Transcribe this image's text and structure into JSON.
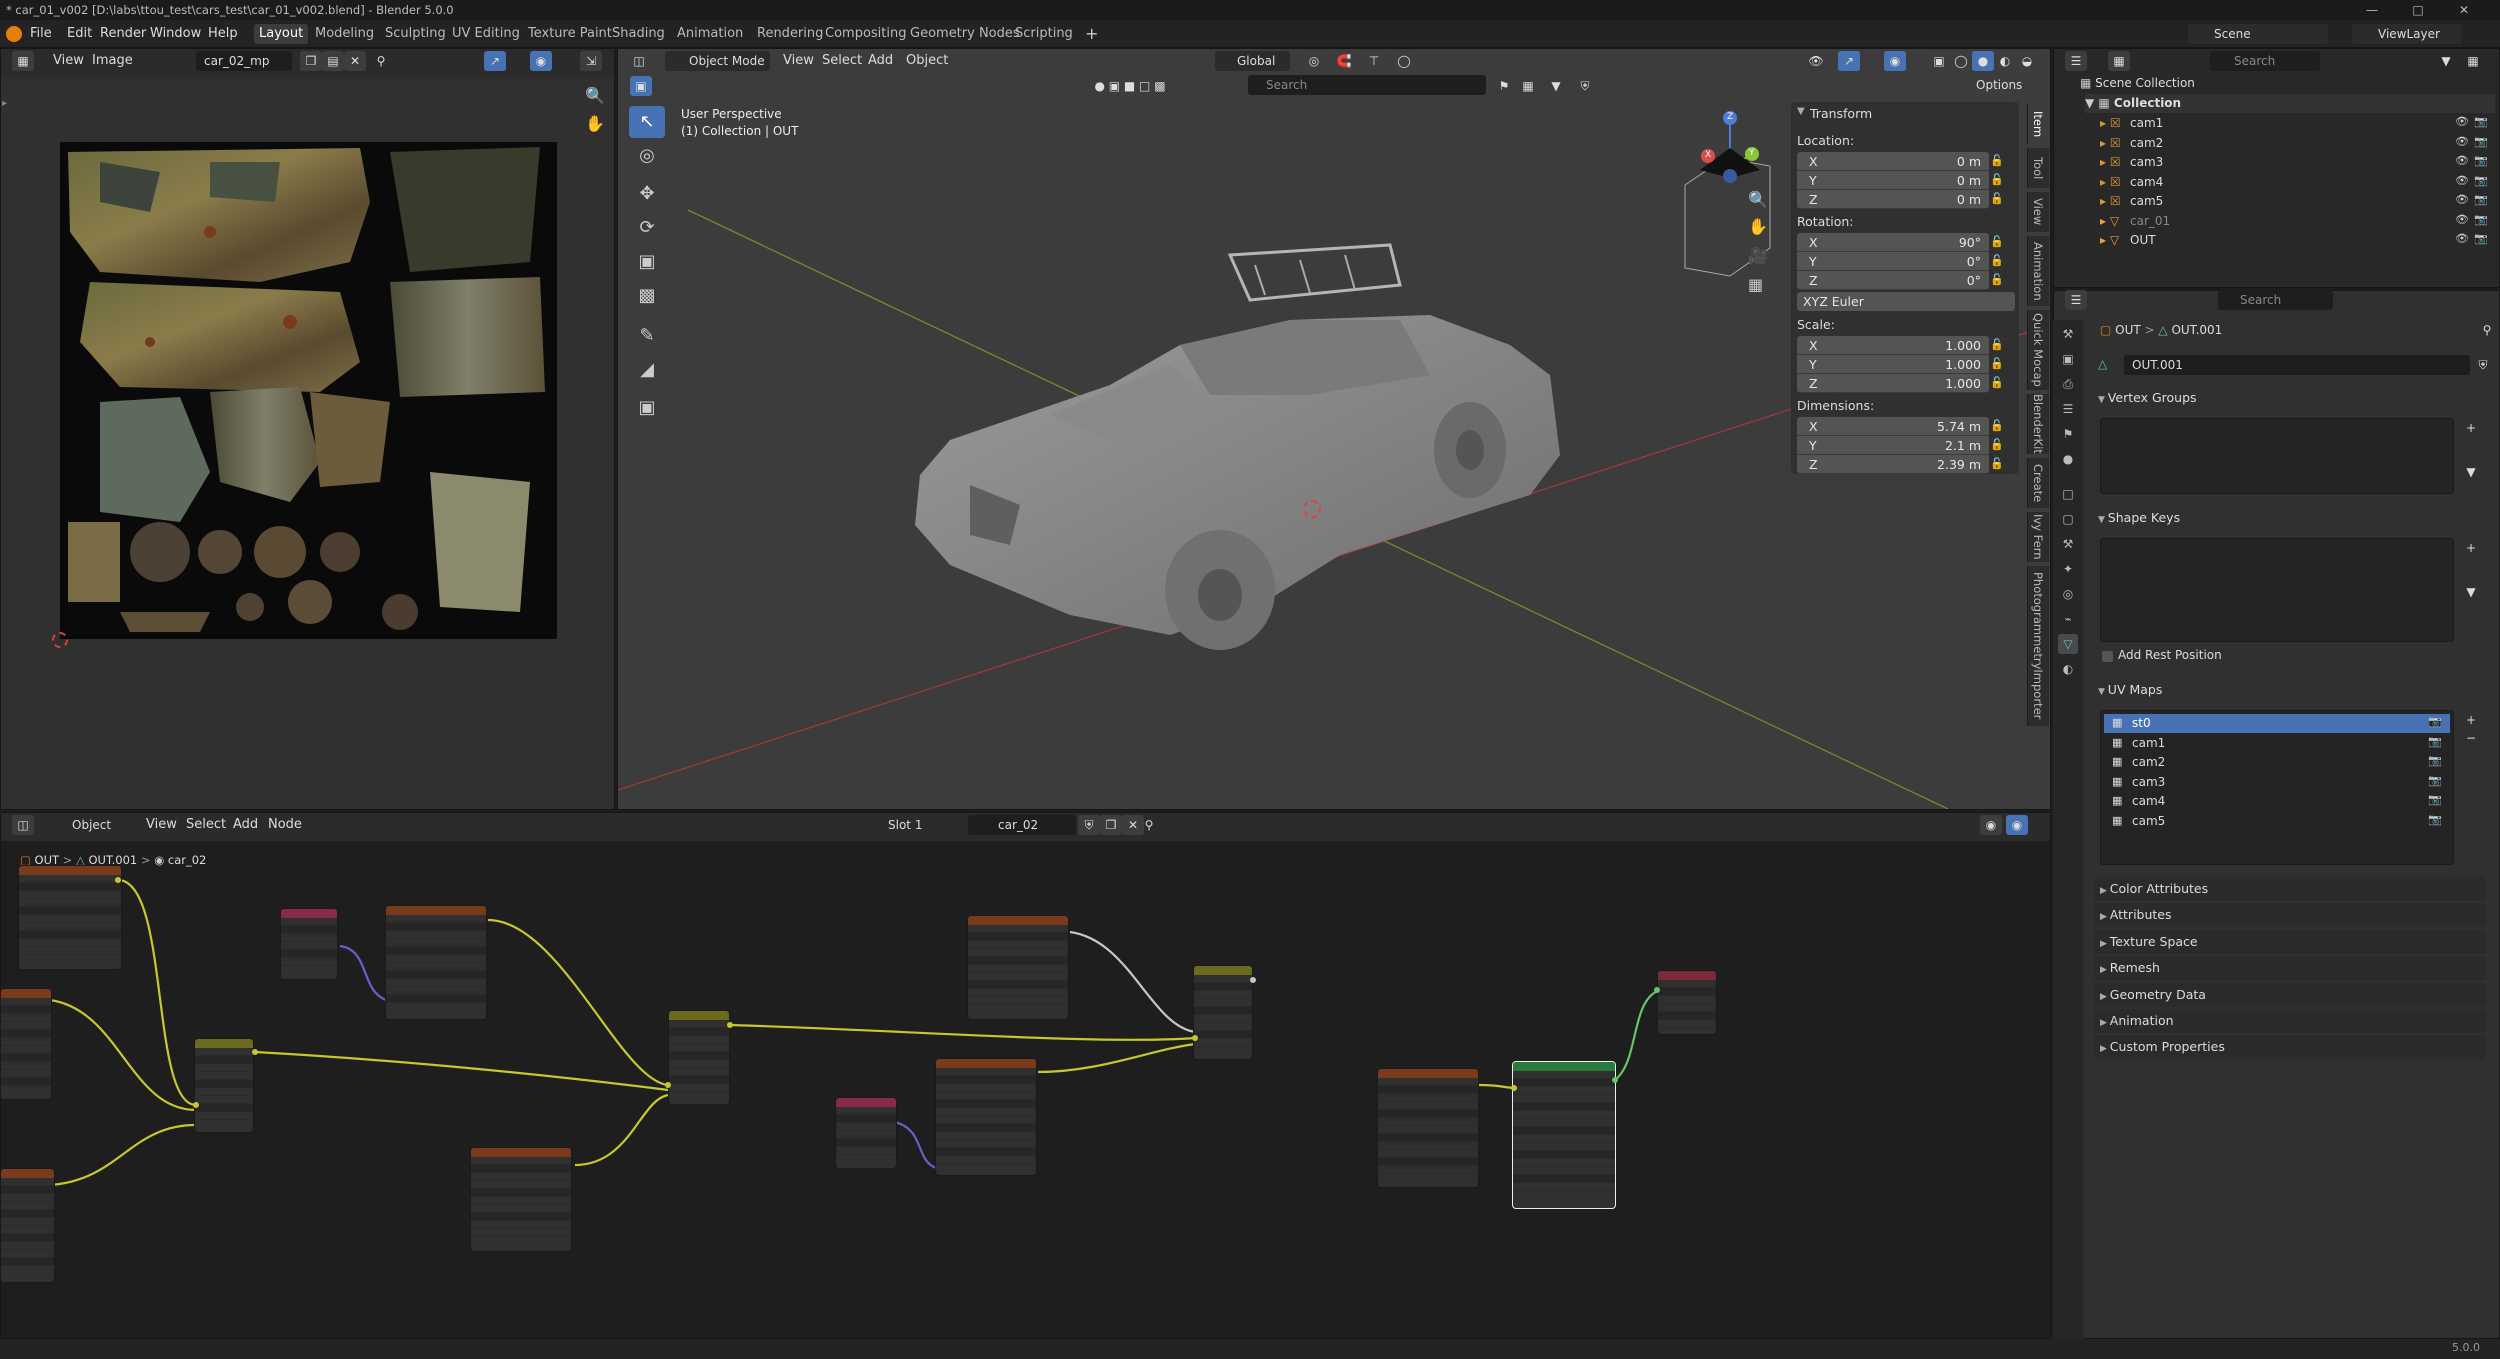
{
  "window": {
    "title": "* car_01_v002 [D:\\labs\\ttou_test\\cars_test\\car_01_v002.blend] - Blender 5.0.0"
  },
  "menus": [
    "File",
    "Edit",
    "Render",
    "Window",
    "Help"
  ],
  "workspaces": [
    "Layout",
    "Modeling",
    "Sculpting",
    "UV Editing",
    "Texture Paint",
    "Shading",
    "Animation",
    "Rendering",
    "Compositing",
    "Geometry Nodes",
    "Scripting"
  ],
  "active_workspace": "Layout",
  "scene": {
    "scene_label": "Scene",
    "viewlayer_label": "ViewLayer"
  },
  "image_editor": {
    "view": "View",
    "image": "Image",
    "image_name": "car_02_mp"
  },
  "viewport": {
    "mode": "Object Mode",
    "menu_view": "View",
    "menu_select": "Select",
    "menu_add": "Add",
    "menu_object": "Object",
    "orientation": "Global",
    "options": "Options",
    "search_placeholder": "Search",
    "overlay_title": "User Perspective",
    "overlay_sub": "(1) Collection | OUT",
    "gizmo": {
      "x": "X",
      "y": "Y",
      "z": "Z"
    }
  },
  "transform_panel": {
    "title": "Transform",
    "location_label": "Location:",
    "location": [
      {
        "a": "X",
        "v": "0 m"
      },
      {
        "a": "Y",
        "v": "0 m"
      },
      {
        "a": "Z",
        "v": "0 m"
      }
    ],
    "rotation_label": "Rotation:",
    "rotation": [
      {
        "a": "X",
        "v": "90°"
      },
      {
        "a": "Y",
        "v": "0°"
      },
      {
        "a": "Z",
        "v": "0°"
      }
    ],
    "rotation_mode": "XYZ Euler",
    "scale_label": "Scale:",
    "scale": [
      {
        "a": "X",
        "v": "1.000"
      },
      {
        "a": "Y",
        "v": "1.000"
      },
      {
        "a": "Z",
        "v": "1.000"
      }
    ],
    "dimensions_label": "Dimensions:",
    "dimensions": [
      {
        "a": "X",
        "v": "5.74 m"
      },
      {
        "a": "Y",
        "v": "2.1 m"
      },
      {
        "a": "Z",
        "v": "2.39 m"
      }
    ]
  },
  "npanel_tabs": [
    "Item",
    "Tool",
    "View",
    "Animation",
    "Quick Mocap",
    "BlenderKit",
    "Create",
    "Ivy Fern",
    "PhotogrammetryImporter"
  ],
  "outliner": {
    "search_placeholder": "Search",
    "scene_collection": "Scene Collection",
    "collection": "Collection",
    "items": [
      "cam1",
      "cam2",
      "cam3",
      "cam4",
      "cam5",
      "car_01",
      "OUT"
    ]
  },
  "properties": {
    "search_placeholder": "Search",
    "breadcrumb_obj": "OUT",
    "breadcrumb_mesh": "OUT.001",
    "mesh_name": "OUT.001",
    "vertex_groups": "Vertex Groups",
    "shape_keys": "Shape Keys",
    "add_rest_position": "Add Rest Position",
    "uv_maps_title": "UV Maps",
    "uv_maps": [
      "st0",
      "cam1",
      "cam2",
      "cam3",
      "cam4",
      "cam5"
    ],
    "collapsed": [
      "Color Attributes",
      "Attributes",
      "Texture Space",
      "Remesh",
      "Geometry Data",
      "Animation",
      "Custom Properties"
    ]
  },
  "node_editor": {
    "object_label": "Object",
    "menu_view": "View",
    "menu_select": "Select",
    "menu_add": "Add",
    "menu_node": "Node",
    "slot": "Slot 1",
    "material": "car_02",
    "breadcrumb": [
      "OUT",
      "OUT.001",
      "car_02"
    ]
  },
  "status": {
    "version": "5.0.0"
  }
}
